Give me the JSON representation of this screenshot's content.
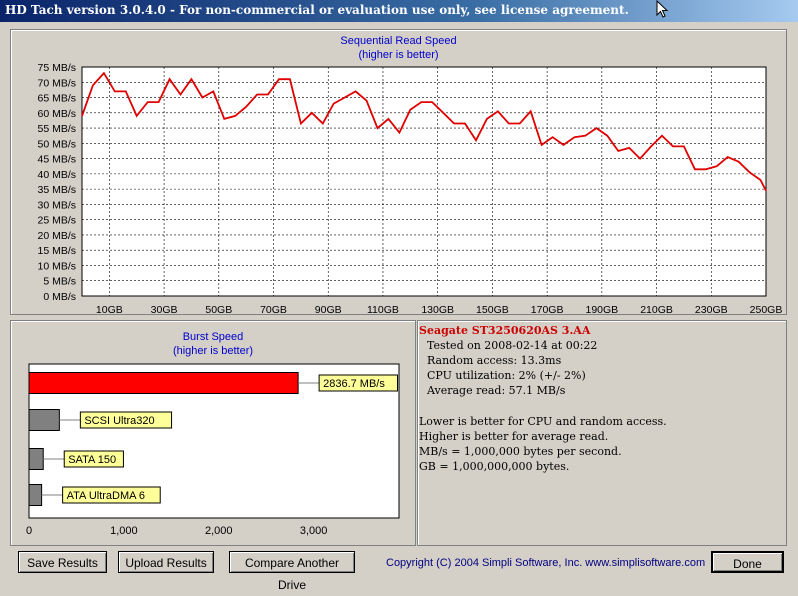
{
  "window": {
    "title": "HD Tach version 3.0.4.0  - For non-commercial or evaluation use only, see license agreement."
  },
  "read_chart": {
    "title_line1": "Sequential Read Speed",
    "title_line2": "(higher is better)"
  },
  "burst_chart": {
    "title_line1": "Burst Speed",
    "title_line2": "(higher is better)"
  },
  "info": {
    "drive": "Seagate ST3250620AS 3.AA",
    "tested_on": "Tested on 2008-02-14 at 00:22",
    "random_access": "Random access: 13.3ms",
    "cpu": "CPU utilization: 2% (+/- 2%)",
    "avg_read": "Average read: 57.1 MB/s",
    "note1": "Lower is better for CPU and random access.",
    "note2": "Higher is better for average read.",
    "note3": "MB/s = 1,000,000 bytes per second.",
    "note4": "GB = 1,000,000,000 bytes."
  },
  "buttons": {
    "save": "Save Results",
    "upload": "Upload Results",
    "compare": "Compare Another Drive",
    "done": "Done"
  },
  "copyright": "Copyright (C) 2004 Simpli Software, Inc. www.simplisoftware.com",
  "colors": {
    "read_line": "#e00000",
    "burst_bar": "#ff0000",
    "ref_bar": "#808080",
    "label_bg": "#ffff99",
    "titlebar": "#0a246a"
  },
  "chart_data": [
    {
      "type": "line",
      "title": "Sequential Read Speed",
      "subtitle": "(higher is better)",
      "xlabel": "",
      "ylabel": "",
      "xlim": [
        0,
        250
      ],
      "ylim": [
        0,
        75
      ],
      "x_ticks": [
        "10GB",
        "30GB",
        "50GB",
        "70GB",
        "90GB",
        "110GB",
        "130GB",
        "150GB",
        "170GB",
        "190GB",
        "210GB",
        "230GB",
        "250GB"
      ],
      "y_ticks": [
        "0 MB/s",
        "5 MB/s",
        "10 MB/s",
        "15 MB/s",
        "20 MB/s",
        "25 MB/s",
        "30 MB/s",
        "35 MB/s",
        "40 MB/s",
        "45 MB/s",
        "50 MB/s",
        "55 MB/s",
        "60 MB/s",
        "65 MB/s",
        "70 MB/s",
        "75 MB/s"
      ],
      "grid": true,
      "series": [
        {
          "x": [
            0,
            4,
            8,
            12,
            16,
            20,
            24,
            28,
            32,
            36,
            40,
            44,
            48,
            52,
            56,
            60,
            64,
            68,
            72,
            76,
            80,
            84,
            88,
            92,
            96,
            100,
            104,
            108,
            112,
            116,
            120,
            124,
            128,
            132,
            136,
            140,
            144,
            148,
            152,
            156,
            160,
            164,
            168,
            172,
            176,
            180,
            184,
            188,
            192,
            196,
            200,
            204,
            208,
            212,
            216,
            220,
            224,
            228,
            232,
            236,
            240,
            244,
            248,
            250
          ],
          "y": [
            59,
            69,
            73,
            67,
            67,
            59,
            63.5,
            63.5,
            71,
            66,
            71,
            65,
            67,
            58,
            59,
            62,
            66,
            66,
            71,
            71,
            56.5,
            60,
            56.5,
            63,
            65,
            67,
            64,
            55,
            58,
            53.5,
            61,
            63.5,
            63.5,
            60,
            56.5,
            56.5,
            51,
            58,
            60.5,
            56.5,
            56.5,
            60.5,
            49.5,
            52,
            49.5,
            52,
            52.5,
            55,
            52.5,
            47.5,
            48.5,
            45,
            49,
            52.5,
            49,
            49,
            41.5,
            41.5,
            42.5,
            45.5,
            44,
            40.5,
            38,
            34.5
          ]
        }
      ]
    },
    {
      "type": "bar",
      "title": "Burst Speed",
      "subtitle": "(higher is better)",
      "orientation": "horizontal",
      "xlim": [
        0,
        3900
      ],
      "x_ticks": [
        "0",
        "1,000",
        "2,000",
        "3,000"
      ],
      "categories": [
        "2836.7 MB/s",
        "SCSI Ultra320",
        "SATA 150",
        "ATA UltraDMA 6"
      ],
      "values": [
        2836.7,
        320,
        150,
        133
      ]
    }
  ]
}
